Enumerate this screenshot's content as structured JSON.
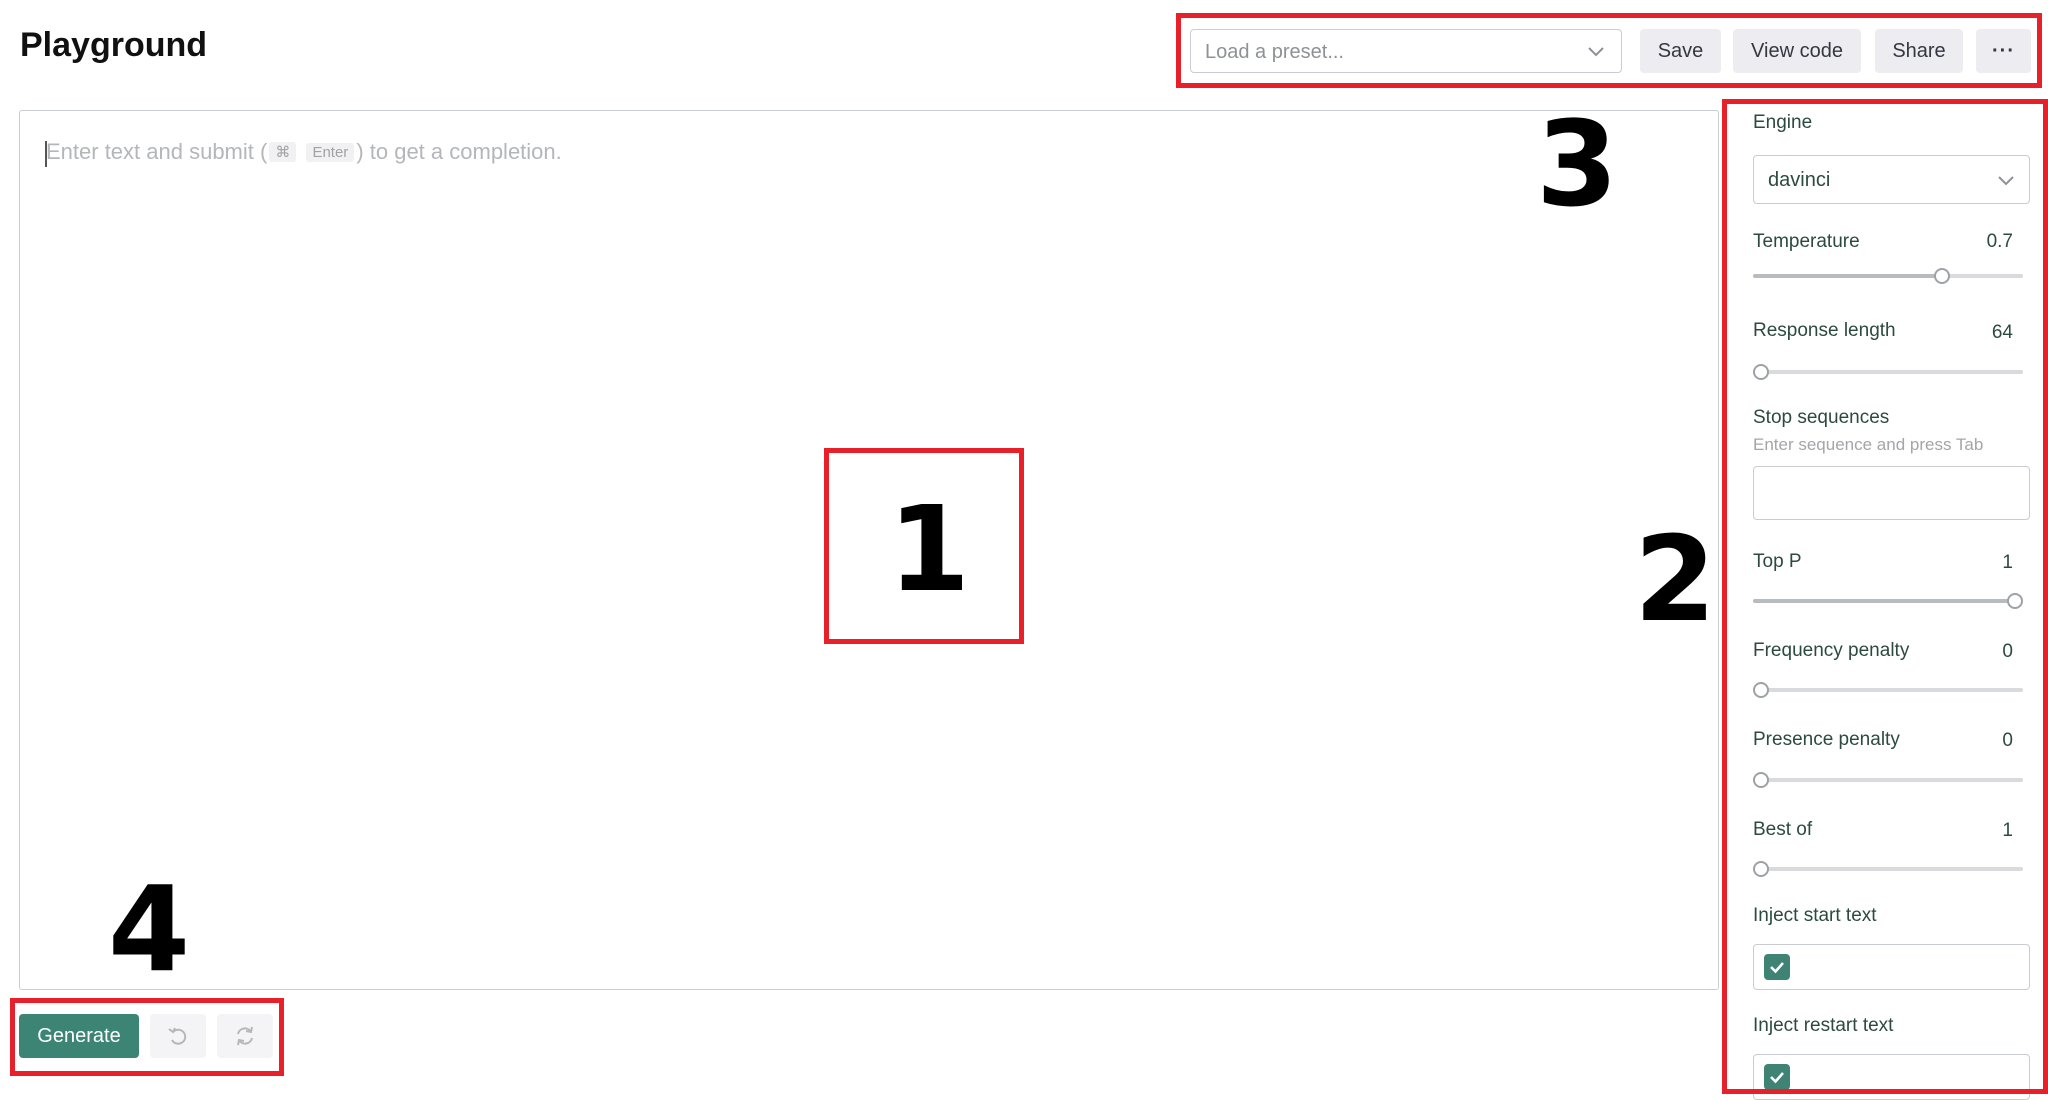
{
  "header": {
    "title": "Playground"
  },
  "toolbar": {
    "preset_placeholder": "Load a preset...",
    "save_label": "Save",
    "view_code_label": "View code",
    "share_label": "Share",
    "more_label": "···"
  },
  "editor": {
    "placeholder_prefix": "Enter text and submit (",
    "key_cmd": "⌘",
    "key_enter": "Enter",
    "placeholder_suffix": ") to get a completion."
  },
  "settings": {
    "engine_label": "Engine",
    "engine_value": "davinci",
    "temperature": {
      "label": "Temperature",
      "value": "0.7",
      "fraction": 0.7
    },
    "response_length": {
      "label": "Response length",
      "value": "64",
      "fraction": 0.03
    },
    "stop_sequences": {
      "label": "Stop sequences",
      "hint": "Enter sequence and press Tab"
    },
    "top_p": {
      "label": "Top P",
      "value": "1",
      "fraction": 1.0
    },
    "frequency_penalty": {
      "label": "Frequency penalty",
      "value": "0",
      "fraction": 0.0
    },
    "presence_penalty": {
      "label": "Presence penalty",
      "value": "0",
      "fraction": 0.0
    },
    "best_of": {
      "label": "Best of",
      "value": "1",
      "fraction": 0.0
    },
    "inject_start_text": {
      "label": "Inject start text",
      "checked": true
    },
    "inject_restart_text": {
      "label": "Inject restart text",
      "checked": true
    }
  },
  "actions": {
    "generate_label": "Generate"
  },
  "annotations": {
    "one": "1",
    "two": "2",
    "three": "3",
    "four": "4"
  },
  "colors": {
    "accent": "#3c8575",
    "highlight": "#e8202a"
  }
}
